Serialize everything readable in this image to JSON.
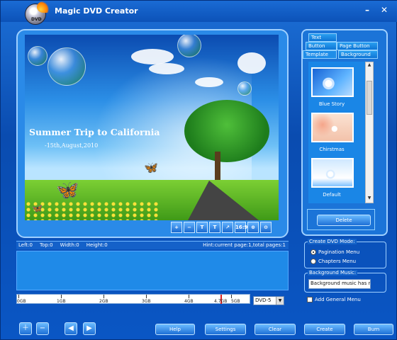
{
  "app": {
    "title": "Magic DVD Creator",
    "logo_text": "DVD"
  },
  "window_controls": {
    "minimize": "–",
    "close": "✕"
  },
  "preview": {
    "title": "Summer Trip to California",
    "subtitle": "-15th,August,2010"
  },
  "preview_toolbar": [
    "+",
    "−",
    "T",
    "T",
    "↗",
    "16:9",
    "⊕",
    "⊖"
  ],
  "info": {
    "left": "Left:0",
    "top": "Top:0",
    "width": "Width:0",
    "height": "Height:0",
    "hint": "Hint:current page:1,total pages:1"
  },
  "meter": {
    "labels": [
      "0GB",
      "1GB",
      "2GB",
      "3GB",
      "4GB",
      "4.7GB",
      "5GB"
    ],
    "disc_select": "DVD-5"
  },
  "tabs": {
    "text": "Text",
    "button": "Button",
    "page_button": "Page Button",
    "template": "Template",
    "background": "Background"
  },
  "templates": [
    {
      "label": "Blue Story"
    },
    {
      "label": "Chirstmas"
    },
    {
      "label": "Default"
    }
  ],
  "buttons": {
    "delete": "Delete",
    "help": "Help",
    "settings": "Settings",
    "clear": "Clear",
    "create": "Create",
    "burn": "Burn"
  },
  "mode": {
    "title": "Create DVD Mode:",
    "pagination": "Pagination Menu",
    "chapters": "Chapters Menu",
    "selected": "Pagination Menu"
  },
  "music": {
    "title": "Background Music:",
    "value": "Background music has no",
    "add_general": "Add General Menu"
  },
  "bottom_icons": {
    "add": "＋",
    "remove": "−",
    "back": "◀",
    "forward": "▶"
  }
}
